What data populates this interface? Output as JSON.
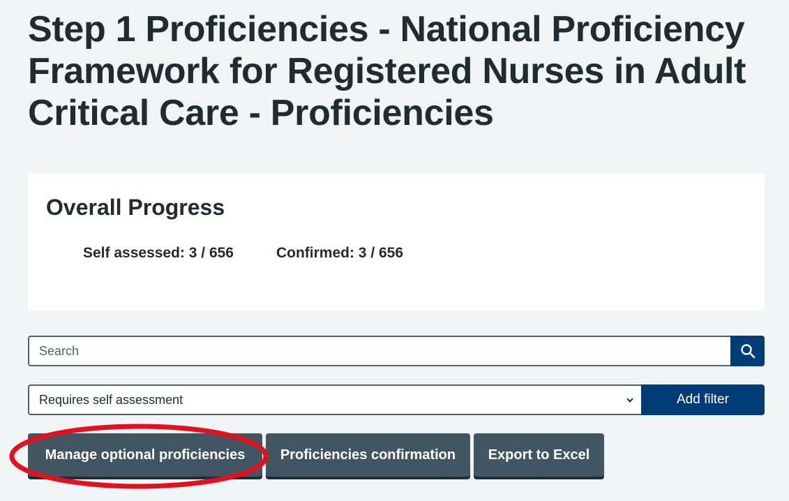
{
  "page": {
    "title": "Step 1 Proficiencies - National Proficiency Framework for Registered Nurses in Adult Critical Care - Proficiencies"
  },
  "progress": {
    "heading": "Overall Progress",
    "self_assessed": "Self assessed: 3 / 656",
    "confirmed": "Confirmed: 3 / 656"
  },
  "search": {
    "placeholder": "Search",
    "icon": "search-icon"
  },
  "filter": {
    "selected": "Requires self assessment",
    "add_label": "Add filter"
  },
  "actions": {
    "manage_label": "Manage optional proficiencies",
    "confirm_label": "Proficiencies confirmation",
    "export_label": "Export to Excel"
  },
  "colors": {
    "background": "#f0f4f5",
    "primary_blue": "#003d78",
    "secondary_button": "#425563",
    "highlight_ring": "#e3101f"
  }
}
